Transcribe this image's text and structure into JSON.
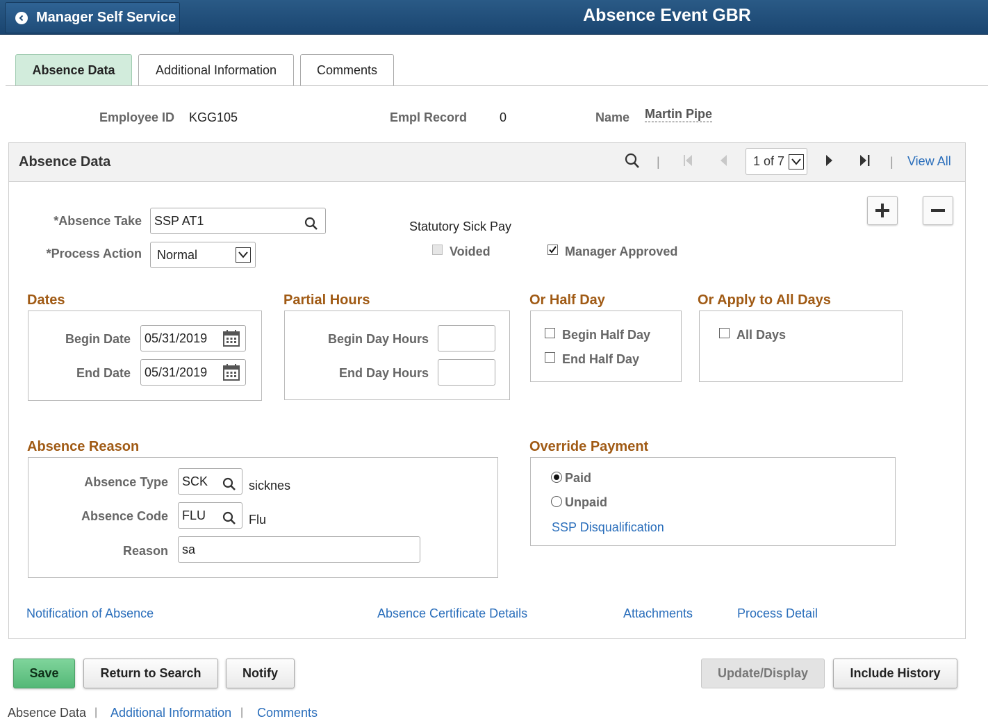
{
  "header": {
    "back_label": "Manager Self Service",
    "title": "Absence Event GBR"
  },
  "tabs": [
    {
      "label": "Absence Data",
      "active": true
    },
    {
      "label": "Additional Information",
      "active": false
    },
    {
      "label": "Comments",
      "active": false
    }
  ],
  "employee": {
    "id_label": "Employee ID",
    "id_value": "KGG105",
    "record_label": "Empl Record",
    "record_value": "0",
    "name_label": "Name",
    "name_value": "Martin Pipe"
  },
  "panel": {
    "title": "Absence Data",
    "pager": "1 of 7",
    "view_all": "View All"
  },
  "absence": {
    "take_label": "*Absence Take",
    "take_value": "SSP AT1",
    "process_label": "*Process Action",
    "process_value": "Normal",
    "ssp_label": "Statutory Sick Pay",
    "voided_label": "Voided",
    "voided_checked": false,
    "manager_label": "Manager Approved",
    "manager_checked": true
  },
  "dates": {
    "title": "Dates",
    "begin_label": "Begin Date",
    "begin_value": "05/31/2019",
    "end_label": "End Date",
    "end_value": "05/31/2019"
  },
  "partial": {
    "title": "Partial Hours",
    "begin_label": "Begin Day Hours",
    "begin_value": "",
    "end_label": "End Day Hours",
    "end_value": ""
  },
  "half_day": {
    "title": "Or Half Day",
    "begin_label": "Begin Half Day",
    "end_label": "End Half Day"
  },
  "all_days": {
    "title": "Or Apply to All Days",
    "label": "All Days"
  },
  "reason": {
    "title": "Absence Reason",
    "type_label": "Absence Type",
    "type_value": "SCK",
    "type_desc": "sicknes",
    "code_label": "Absence Code",
    "code_value": "FLU",
    "code_desc": "Flu",
    "reason_label": "Reason",
    "reason_value": "sa"
  },
  "override": {
    "title": "Override Payment",
    "paid_label": "Paid",
    "unpaid_label": "Unpaid",
    "selected": "Paid",
    "link": "SSP Disqualification"
  },
  "links": {
    "notification": "Notification of Absence",
    "certificate": "Absence Certificate Details",
    "attachments": "Attachments",
    "process_detail": "Process Detail"
  },
  "buttons": {
    "save": "Save",
    "return": "Return to Search",
    "notify": "Notify",
    "update": "Update/Display",
    "history": "Include History"
  },
  "footer": {
    "current": "Absence Data",
    "additional": "Additional Information",
    "comments": "Comments"
  },
  "colors": {
    "header": "#1f4c78",
    "section_title": "#a05a14",
    "link": "#2a6ebb",
    "primary_button": "#5fc080"
  }
}
